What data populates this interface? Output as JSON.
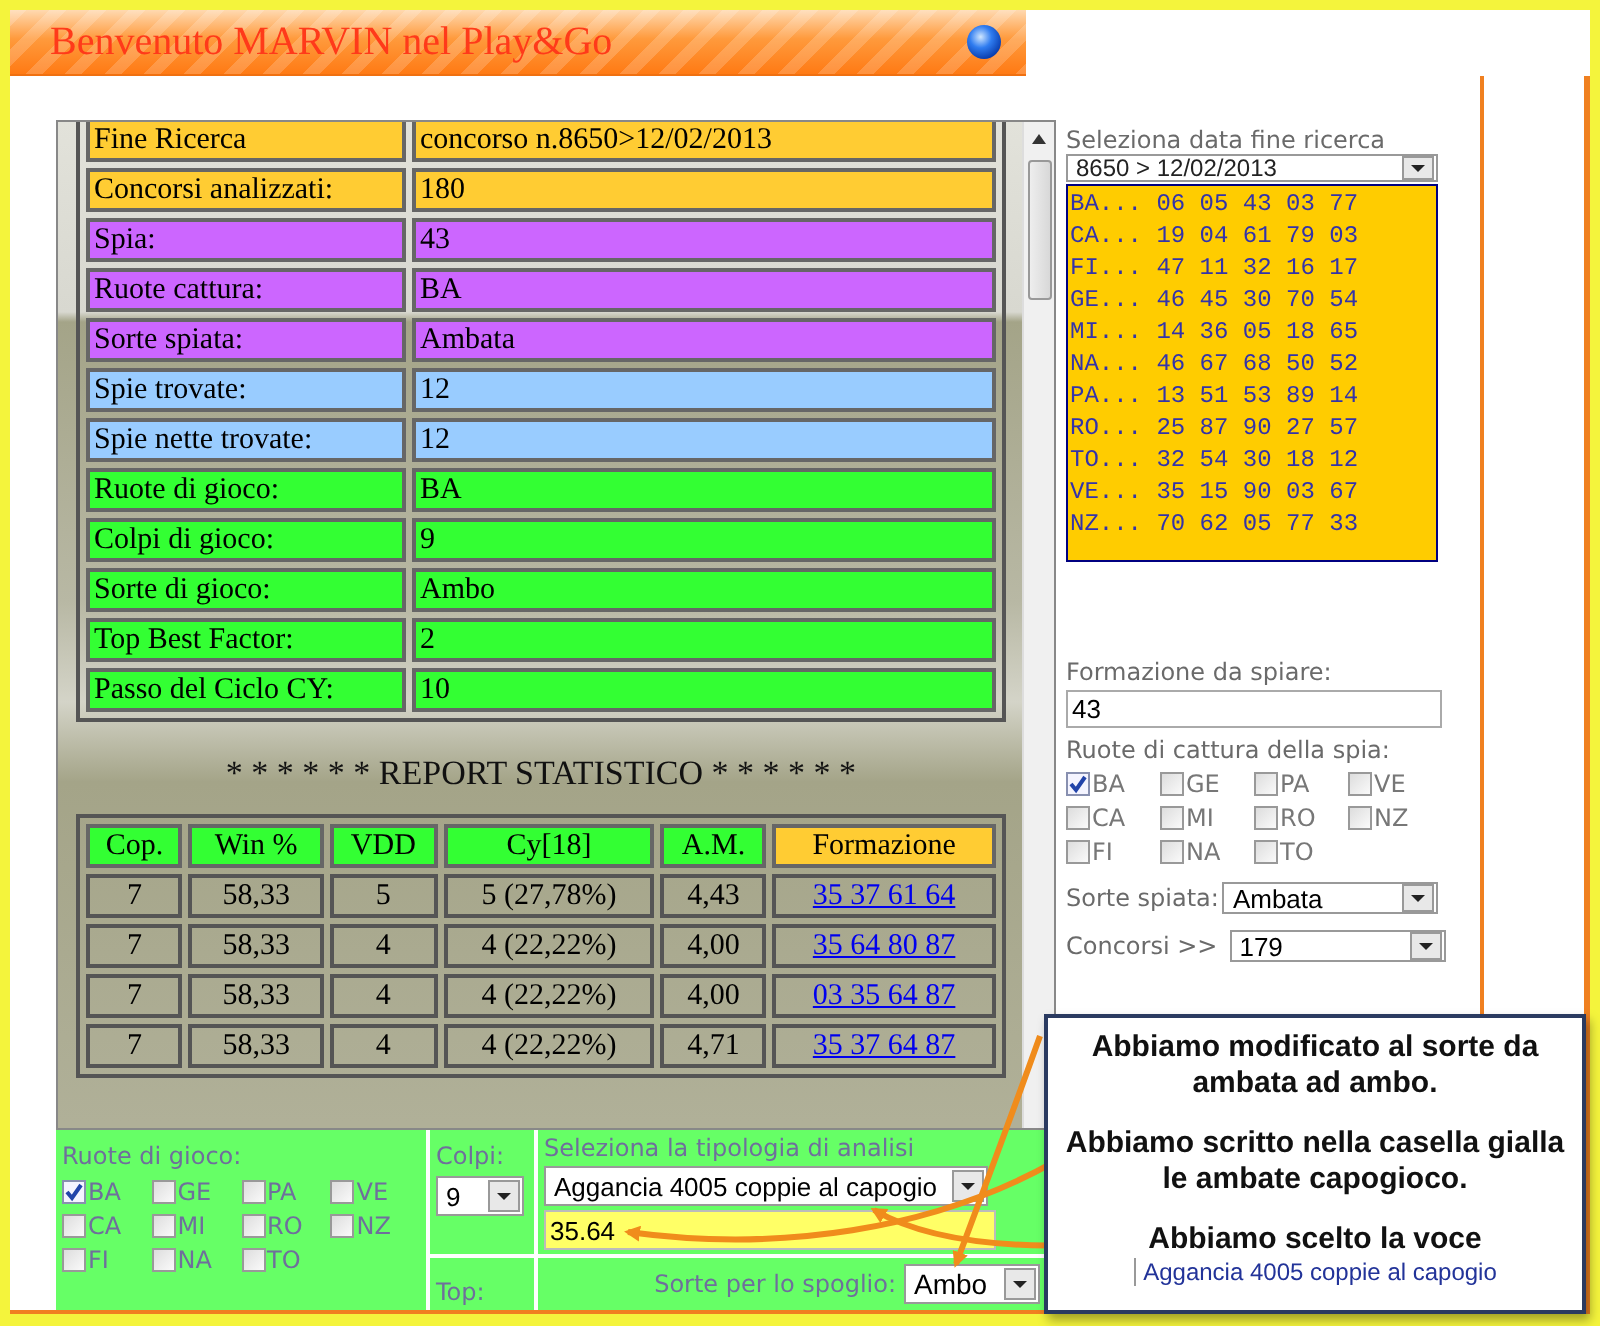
{
  "header": {
    "title": "Benvenuto MARVIN nel Play&Go"
  },
  "summary": [
    {
      "label": "Fine Ricerca",
      "value": "concorso n.8650>12/02/2013",
      "color": "#ffcc33"
    },
    {
      "label": "Concorsi analizzati:",
      "value": "180",
      "color": "#ffcc33"
    },
    {
      "label": "Spia:",
      "value": "43",
      "color": "#cc66ff"
    },
    {
      "label": "Ruote cattura:",
      "value": "BA",
      "color": "#cc66ff"
    },
    {
      "label": "Sorte spiata:",
      "value": "Ambata",
      "color": "#cc66ff"
    },
    {
      "label": "Spie trovate:",
      "value": "12",
      "color": "#99ccff"
    },
    {
      "label": "Spie nette trovate:",
      "value": "12",
      "color": "#99ccff"
    },
    {
      "label": "Ruote di gioco:",
      "value": "BA",
      "color": "#33ff33"
    },
    {
      "label": "Colpi di gioco:",
      "value": "9",
      "color": "#33ff33"
    },
    {
      "label": "Sorte di gioco:",
      "value": "Ambo",
      "color": "#33ff33"
    },
    {
      "label": "Top Best Factor:",
      "value": "2",
      "color": "#33ff33"
    },
    {
      "label": "Passo del Ciclo CY:",
      "value": "10",
      "color": "#33ff33"
    }
  ],
  "report_title": "* * * * * * REPORT STATISTICO * * * * * *",
  "stats": {
    "columns": [
      {
        "label": "Cop.",
        "color": "#33ff33"
      },
      {
        "label": "Win %",
        "color": "#33ff33"
      },
      {
        "label": "VDD",
        "color": "#33ff33"
      },
      {
        "label": "Cy[18]",
        "color": "#33ff33"
      },
      {
        "label": "A.M.",
        "color": "#33ff33"
      },
      {
        "label": "Formazione",
        "color": "#ffcc33"
      }
    ],
    "rows": [
      {
        "cop": "7",
        "win": "58,33",
        "vdd": "5",
        "cy": "5 (27,78%)",
        "am": "4,43",
        "formazione": "35 37 61 64"
      },
      {
        "cop": "7",
        "win": "58,33",
        "vdd": "4",
        "cy": "4 (22,22%)",
        "am": "4,00",
        "formazione": "35 64 80 87"
      },
      {
        "cop": "7",
        "win": "58,33",
        "vdd": "4",
        "cy": "4 (22,22%)",
        "am": "4,00",
        "formazione": "03 35 64 87"
      },
      {
        "cop": "7",
        "win": "58,33",
        "vdd": "4",
        "cy": "4 (22,22%)",
        "am": "4,71",
        "formazione": "35 37 64 87"
      }
    ]
  },
  "bottom_panel": {
    "ruote_label": "Ruote di gioco:",
    "ruote": [
      {
        "label": "BA",
        "checked": true
      },
      {
        "label": "GE",
        "checked": false
      },
      {
        "label": "PA",
        "checked": false
      },
      {
        "label": "VE",
        "checked": false
      },
      {
        "label": "CA",
        "checked": false
      },
      {
        "label": "MI",
        "checked": false
      },
      {
        "label": "RO",
        "checked": false
      },
      {
        "label": "NZ",
        "checked": false
      },
      {
        "label": "FI",
        "checked": false
      },
      {
        "label": "NA",
        "checked": false
      },
      {
        "label": "TO",
        "checked": false
      }
    ],
    "colpi_label": "Colpi:",
    "colpi_value": "9",
    "tipologia_label": "Seleziona la tipologia di analisi",
    "tipologia_value": "Aggancia 4005 coppie al capogio",
    "capogioco_value": "35.64",
    "top_label": "Top:",
    "sorte_label": "Sorte per lo spoglio:",
    "sorte_value": "Ambo"
  },
  "right_panel": {
    "date_label": "Seleziona data fine ricerca",
    "date_value": "8650 > 12/02/2013",
    "estrazioni": [
      "BA... 06 05 43 03 77",
      "CA... 19 04 61 79 03",
      "FI... 47 11 32 16 17",
      "GE... 46 45 30 70 54",
      "MI... 14 36 05 18 65",
      "NA... 46 67 68 50 52",
      "PA... 13 51 53 89 14",
      "RO... 25 87 90 27 57",
      "TO... 32 54 30 18 12",
      "VE... 35 15 90 03 67",
      "NZ... 70 62 05 77 33"
    ],
    "formazione_label": "Formazione da spiare:",
    "formazione_value": "43",
    "ruote_label": "Ruote di cattura della spia:",
    "ruote": [
      {
        "label": "BA",
        "checked": true
      },
      {
        "label": "GE",
        "checked": false
      },
      {
        "label": "PA",
        "checked": false
      },
      {
        "label": "VE",
        "checked": false
      },
      {
        "label": "CA",
        "checked": false
      },
      {
        "label": "MI",
        "checked": false
      },
      {
        "label": "RO",
        "checked": false
      },
      {
        "label": "NZ",
        "checked": false
      },
      {
        "label": "FI",
        "checked": false
      },
      {
        "label": "NA",
        "checked": false
      },
      {
        "label": "TO",
        "checked": false
      }
    ],
    "sorte_label": "Sorte spiata:",
    "sorte_value": "Ambata",
    "concorsi_label": "Concorsi >>",
    "concorsi_value": "179"
  },
  "callout": {
    "notes": [
      "Abbiamo modificato al sorte da ambata ad ambo.",
      "Abbiamo scritto nella casella gialla le ambate capogioco.",
      "Abbiamo scelto la voce"
    ],
    "option": "Aggancia 4005 coppie al capogio"
  }
}
